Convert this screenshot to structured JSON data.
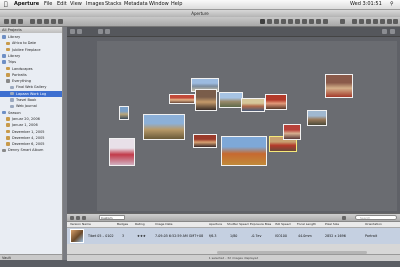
{
  "menubar": {
    "app": "Aperture",
    "items": [
      "File",
      "Edit",
      "View",
      "Images",
      "Stacks",
      "Metadata",
      "Window",
      "Help"
    ],
    "clock": "Wed 3:01:51"
  },
  "window": {
    "title": "Aperture"
  },
  "projects": {
    "header": "All Projects",
    "items": [
      {
        "label": "Library",
        "color": "#6e8fc5"
      },
      {
        "label": "Africa to Date",
        "color": "#c89a4a"
      },
      {
        "label": "Jubilee Fireplace",
        "color": "#c89a4a"
      },
      {
        "label": "Library",
        "color": "#6e8fc5"
      },
      {
        "label": "Trips",
        "color": "#6e8fc5"
      },
      {
        "label": "Landscapes",
        "color": "#c89a4a"
      },
      {
        "label": "Portraits",
        "color": "#c89a4a"
      },
      {
        "label": "Everything",
        "color": "#8a8a8a"
      },
      {
        "label": "Final Web Gallery",
        "color": "#9aa8bf"
      },
      {
        "label": "Lapaan Work Log",
        "color": "#9aa8bf",
        "selected": true
      },
      {
        "label": "Travel Book",
        "color": "#9aa8bf"
      },
      {
        "label": "Web Journal",
        "color": "#9aa8bf"
      },
      {
        "label": "Season",
        "color": "#6e8fc5"
      },
      {
        "label": "Januar 20, 2006",
        "color": "#c89a4a"
      },
      {
        "label": "Januar 1, 2006",
        "color": "#c89a4a"
      },
      {
        "label": "Dezember 1, 2005",
        "color": "#c89a4a"
      },
      {
        "label": "Dezember 4, 2005",
        "color": "#c89a4a"
      },
      {
        "label": "Dezember 6, 2005",
        "color": "#c89a4a"
      },
      {
        "label": "Denny Smart Album",
        "color": "#8a8a8a"
      }
    ],
    "footer": "Vault"
  },
  "browser": {
    "filter_label": "Custom",
    "search_placeholder": "Search",
    "columns": [
      "Version Name",
      "Badges",
      "Rating",
      "Image Date",
      "Aperture",
      "Shutter Speed",
      "Exposure Bias",
      "ISO Speed",
      "Focal Length",
      "Pixel Size",
      "Orientation"
    ],
    "row": {
      "version_name": "Tibet 05 – 0102",
      "badges": "3",
      "rating": "★★★",
      "image_date": "7-09-05 6:52:59 AM GMT+08",
      "aperture": "f/6.3",
      "shutter": "1/80",
      "exposure": "-0.7ev",
      "iso": "ISO100",
      "focal_length": "44.0mm",
      "pixel_size": "2852 x 1696",
      "orientation": "Portrait"
    },
    "status": "1 selected - 32 images displayed"
  },
  "photos": [
    {
      "name": "photo-mountain-lake",
      "colors": [
        "#9cbbe0",
        "#7c8da0",
        "#c8c2a8"
      ]
    },
    {
      "name": "photo-crowd",
      "colors": [
        "#c24a3a",
        "#e5b388",
        "#6b4a3a"
      ]
    },
    {
      "name": "photo-monk-portrait",
      "colors": [
        "#7a5d4a",
        "#c59a6a",
        "#3b2e28"
      ]
    },
    {
      "name": "photo-valley",
      "colors": [
        "#a6c3e3",
        "#9a8a6a",
        "#5d6a4a"
      ]
    },
    {
      "name": "photo-people-field",
      "colors": [
        "#d6c79a",
        "#b06a4a",
        "#4a5d7a"
      ]
    },
    {
      "name": "photo-red-crowd",
      "colors": [
        "#b33a2a",
        "#e39a7a",
        "#5a3a2a"
      ]
    },
    {
      "name": "photo-group-right",
      "colors": [
        "#8a5a4a",
        "#d4b08a",
        "#a33a2a"
      ]
    },
    {
      "name": "photo-small-figure",
      "colors": [
        "#7aa0c8",
        "#b8a67a",
        "#3a4a5a"
      ]
    },
    {
      "name": "photo-landscape-wide",
      "colors": [
        "#8cb0d8",
        "#b89a6a",
        "#6a5a3a"
      ]
    },
    {
      "name": "photo-ritual",
      "colors": [
        "#9a3a2a",
        "#d8a070",
        "#3a2a2a"
      ]
    },
    {
      "name": "photo-collage",
      "colors": [
        "#e8e0e8",
        "#c23a4a",
        "#d0b0c0"
      ]
    },
    {
      "name": "photo-dancers",
      "colors": [
        "#7ea8d8",
        "#c7692f",
        "#c08a3a"
      ]
    },
    {
      "name": "photo-tibet-selected",
      "colors": [
        "#c7a070",
        "#b43a2a",
        "#6a4a3a"
      ]
    },
    {
      "name": "photo-temple-small",
      "colors": [
        "#a0b8d0",
        "#9a7a5a",
        "#4a4a3a"
      ]
    },
    {
      "name": "photo-red-people",
      "colors": [
        "#b8423a",
        "#d8b090",
        "#5a3a3a"
      ]
    }
  ]
}
